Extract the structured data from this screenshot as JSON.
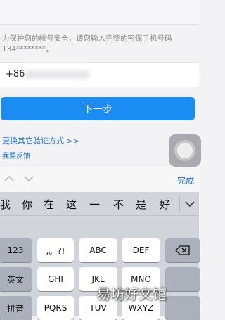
{
  "form": {
    "notice": "为保护您的帐号安全，请您输入完整的密保手机号码134********。",
    "country_code": "+86",
    "next_button": "下一步",
    "other_verify_link": "更换其它验证方式 >>",
    "feedback_link": "我要反馈"
  },
  "accessory_bar": {
    "done_label": "完成"
  },
  "keyboard": {
    "candidates": [
      "我",
      "你",
      "在",
      "这",
      "一",
      "不",
      "是",
      "好"
    ],
    "rows": [
      [
        "123",
        ",。?!",
        "ABC",
        "DEF",
        "⌫"
      ],
      [
        "英文",
        "GHI",
        "JKL",
        "MNO",
        ""
      ],
      [
        "拼音",
        "PQRS",
        "TUV",
        "WXYZ",
        ""
      ]
    ]
  },
  "watermark": "易坊好文馆"
}
